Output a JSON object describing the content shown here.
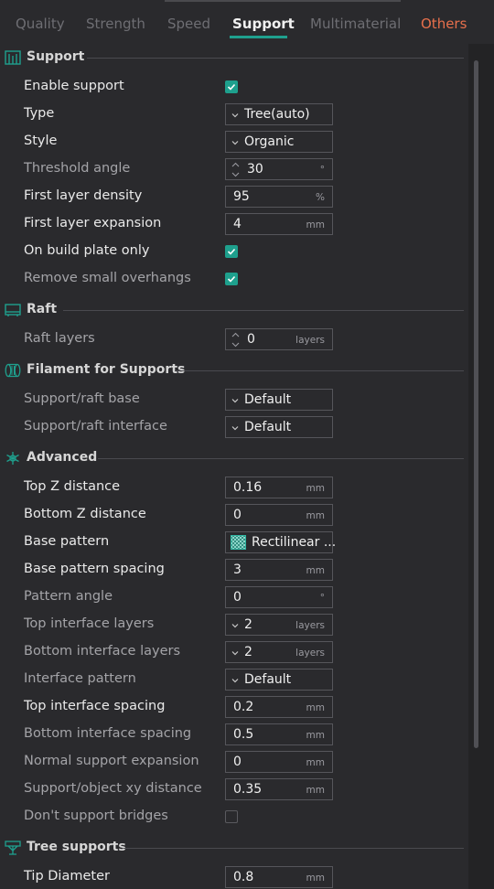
{
  "tabs": [
    {
      "label": "Quality"
    },
    {
      "label": "Strength"
    },
    {
      "label": "Speed"
    },
    {
      "label": "Support"
    },
    {
      "label": "Multimaterial"
    },
    {
      "label": "Others"
    }
  ],
  "colors": {
    "accent": "#1fa08e",
    "others_tab": "#e8704c",
    "background": "#2a2a2d"
  },
  "sections": {
    "support": {
      "title": "Support",
      "icon": "support-icon"
    },
    "raft": {
      "title": "Raft",
      "icon": "raft-icon"
    },
    "filament": {
      "title": "Filament for Supports",
      "icon": "filament-icon"
    },
    "advanced": {
      "title": "Advanced",
      "icon": "advanced-icon"
    },
    "tree": {
      "title": "Tree supports",
      "icon": "tree-support-icon"
    }
  },
  "settings": {
    "enable_support": {
      "label": "Enable support",
      "checked": true
    },
    "type": {
      "label": "Type",
      "value": "Tree(auto)"
    },
    "style": {
      "label": "Style",
      "value": "Organic"
    },
    "threshold_angle": {
      "label": "Threshold angle",
      "value": "30",
      "unit": "°"
    },
    "first_layer_density": {
      "label": "First layer density",
      "value": "95",
      "unit": "%"
    },
    "first_layer_expansion": {
      "label": "First layer expansion",
      "value": "4",
      "unit": "mm"
    },
    "on_build_plate_only": {
      "label": "On build plate only",
      "checked": true
    },
    "remove_small_overhangs": {
      "label": "Remove small overhangs",
      "checked": true
    },
    "raft_layers": {
      "label": "Raft layers",
      "value": "0",
      "unit": "layers"
    },
    "support_raft_base": {
      "label": "Support/raft base",
      "value": "Default"
    },
    "support_raft_interface": {
      "label": "Support/raft interface",
      "value": "Default"
    },
    "top_z_distance": {
      "label": "Top Z distance",
      "value": "0.16",
      "unit": "mm"
    },
    "bottom_z_distance": {
      "label": "Bottom Z distance",
      "value": "0",
      "unit": "mm"
    },
    "base_pattern": {
      "label": "Base pattern",
      "value": "Rectilinear ..."
    },
    "base_pattern_spacing": {
      "label": "Base pattern spacing",
      "value": "3",
      "unit": "mm"
    },
    "pattern_angle": {
      "label": "Pattern angle",
      "value": "0",
      "unit": "°"
    },
    "top_interface_layers": {
      "label": "Top interface layers",
      "value": "2",
      "unit": "layers"
    },
    "bottom_interface_layers": {
      "label": "Bottom interface layers",
      "value": "2",
      "unit": "layers"
    },
    "interface_pattern": {
      "label": "Interface pattern",
      "value": "Default"
    },
    "top_interface_spacing": {
      "label": "Top interface spacing",
      "value": "0.2",
      "unit": "mm"
    },
    "bottom_interface_spacing": {
      "label": "Bottom interface spacing",
      "value": "0.5",
      "unit": "mm"
    },
    "normal_support_expansion": {
      "label": "Normal support expansion",
      "value": "0",
      "unit": "mm"
    },
    "support_object_xy_distance": {
      "label": "Support/object xy distance",
      "value": "0.35",
      "unit": "mm"
    },
    "dont_support_bridges": {
      "label": "Don't support bridges",
      "checked": false
    },
    "tip_diameter": {
      "label": "Tip Diameter",
      "value": "0.8",
      "unit": "mm"
    }
  }
}
